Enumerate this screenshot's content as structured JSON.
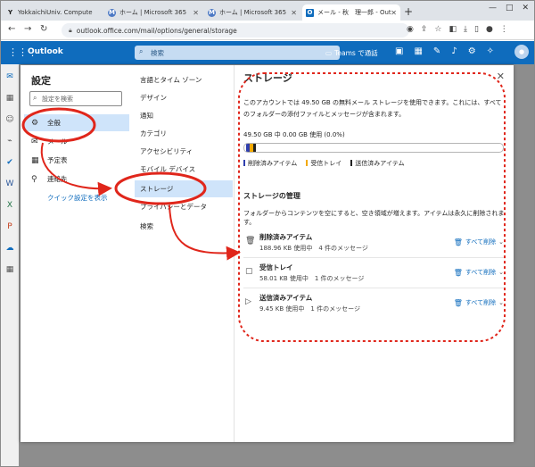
{
  "browser": {
    "tabs": [
      {
        "title": "YokkaichiUniv. Compute",
        "icon": "Y"
      },
      {
        "title": "ホーム | Microsoft 365",
        "icon": "M"
      },
      {
        "title": "ホーム | Microsoft 365",
        "icon": "M"
      },
      {
        "title": "メール - 秋　理一郎 - Out",
        "icon": "O"
      }
    ],
    "new_tab": "+",
    "window_buttons": [
      "—",
      "□",
      "✕"
    ],
    "url": "outlook.office.com/mail/options/general/storage"
  },
  "outlook": {
    "app_name": "Outlook",
    "search_placeholder": "検索",
    "teams_label": "Teams で通話"
  },
  "settings": {
    "title": "設定",
    "search_placeholder": "設定を検索",
    "nav": [
      {
        "label": "全般",
        "icon": "gear-icon"
      },
      {
        "label": "メール",
        "icon": "mail-icon"
      },
      {
        "label": "予定表",
        "icon": "calendar-icon"
      },
      {
        "label": "連絡先",
        "icon": "people-icon"
      }
    ],
    "quick_settings": "クイック設定を表示",
    "subnav": [
      "言語とタイム ゾーン",
      "デザイン",
      "通知",
      "カテゴリ",
      "アクセシビリティ",
      "モバイル デバイス",
      "ストレージ",
      "プライバシーとデータ",
      "検索"
    ]
  },
  "storage": {
    "title": "ストレージ",
    "description": "このアカウントでは 49.50 GB の無料メール ストレージを使用できます。これには、すべてのフォルダーの添付ファイルとメッセージが含まれます。",
    "usage": "49.50 GB 中 0.00 GB 使用 (0.0%)",
    "usage_fraction": 0.0,
    "legend": [
      {
        "label": "削除済みアイテム",
        "color": "#2f3fae"
      },
      {
        "label": "受信トレイ",
        "color": "#f2a900"
      },
      {
        "label": "送信済みアイテム",
        "color": "#222222"
      }
    ],
    "manage_title": "ストレージの管理",
    "manage_desc": "フォルダーからコンテンツを空にすると、空き領域が増えます。アイテムは永久に削除されます。",
    "folders": [
      {
        "name": "削除済みアイテム",
        "size": "188.96 KB 使用中　4 件のメッセージ",
        "action": "すべて削除",
        "icon": "trash-folder-icon"
      },
      {
        "name": "受信トレイ",
        "size": "58.01 KB 使用中　1 件のメッセージ",
        "action": "すべて削除",
        "icon": "inbox-icon"
      },
      {
        "name": "送信済みアイテム",
        "size": "9.45 KB 使用中　1 件のメッセージ",
        "action": "すべて削除",
        "icon": "send-icon"
      }
    ]
  }
}
